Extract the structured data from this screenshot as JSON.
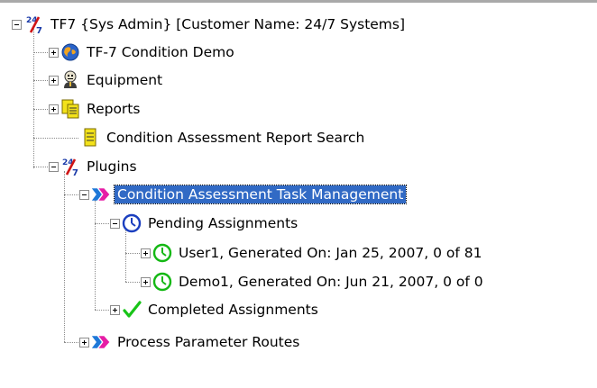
{
  "tree": {
    "root": {
      "label": "TF7 {Sys Admin} [Customer Name: 24/7 Systems]",
      "expanded": true,
      "icon": "logo-24-7-icon"
    },
    "condition_demo": {
      "label": "TF-7 Condition Demo",
      "expanded": false,
      "icon": "globe-icon"
    },
    "equipment": {
      "label": "Equipment",
      "expanded": false,
      "icon": "robot-icon"
    },
    "reports": {
      "label": "Reports",
      "expanded": false,
      "icon": "report-stack-icon"
    },
    "report_search": {
      "label": "Condition Assessment Report Search",
      "icon": "report-page-icon"
    },
    "plugins": {
      "label": "Plugins",
      "expanded": true,
      "icon": "logo-24-7-icon"
    },
    "task_mgmt": {
      "label": "Condition Assessment Task Management",
      "expanded": true,
      "selected": true,
      "icon": "arrow-plugin-icon"
    },
    "pending": {
      "label": "Pending Assignments",
      "expanded": true,
      "icon": "blue-clock-icon"
    },
    "user1": {
      "label": "User1, Generated On: Jan 25, 2007, 0 of 81",
      "expanded": false,
      "icon": "green-clock-icon"
    },
    "demo1": {
      "label": "Demo1, Generated On: Jun 21, 2007, 0 of 0",
      "expanded": false,
      "icon": "green-clock-icon"
    },
    "completed": {
      "label": "Completed Assignments",
      "expanded": false,
      "icon": "checkmark-icon"
    },
    "process_routes": {
      "label": "Process Parameter Routes",
      "expanded": false,
      "icon": "arrow-plugin-icon"
    }
  },
  "colors": {
    "selection": "#316ac5",
    "tree_lines": "#8a8a8a"
  }
}
